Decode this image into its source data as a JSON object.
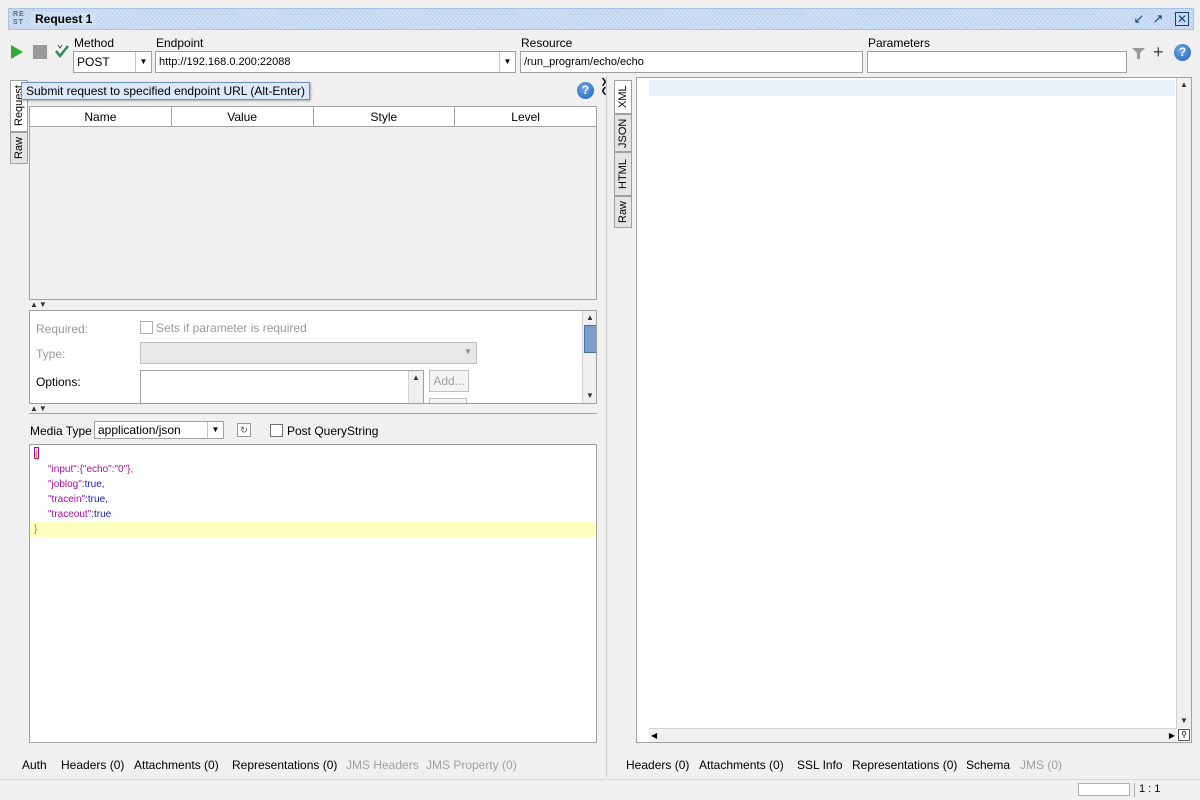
{
  "window": {
    "title": "Request 1",
    "logo_text": "RE ST"
  },
  "toolbar": {
    "method_label": "Method",
    "method_value": "POST",
    "endpoint_label": "Endpoint",
    "endpoint_value": "http://192.168.0.200:22088",
    "resource_label": "Resource",
    "resource_value": "/run_program/echo/echo",
    "parameters_label": "Parameters",
    "parameters_value": "",
    "icons": [
      "play-icon",
      "stop-icon",
      "check-icon",
      "clear-icon",
      "plus-icon",
      "help-icon"
    ]
  },
  "left_panel": {
    "tabs": [
      "Request",
      "Raw"
    ],
    "tooltip": "Submit request to specified endpoint URL (Alt-Enter)",
    "table_columns": [
      "Name",
      "Value",
      "Style",
      "Level"
    ],
    "details": {
      "required_label": "Required:",
      "required_checkbox_label": "Sets if parameter is required",
      "type_label": "Type:",
      "options_label": "Options:",
      "add_button": "Add..."
    },
    "media_type_label": "Media Type",
    "media_type_value": "application/json",
    "post_querystring_label": "Post QueryString",
    "body_lines": [
      {
        "text": "{",
        "kind": "brace"
      },
      {
        "key": "\"input\"",
        "value": ":{\"echo\":\"0\"},"
      },
      {
        "key": "\"joblog\"",
        "value": ":true,"
      },
      {
        "key": "\"tracein\"",
        "value": ":true,"
      },
      {
        "key": "\"traceout\"",
        "value": ":true"
      },
      {
        "text": "}",
        "kind": "brace"
      }
    ],
    "bottom_tabs": [
      {
        "label": "Auth",
        "enabled": true
      },
      {
        "label": "Headers (0)",
        "enabled": true
      },
      {
        "label": "Attachments (0)",
        "enabled": true
      },
      {
        "label": "Representations (0)",
        "enabled": true
      },
      {
        "label": "JMS Headers",
        "enabled": false
      },
      {
        "label": "JMS Property (0)",
        "enabled": false
      }
    ]
  },
  "right_panel": {
    "tabs": [
      "XML",
      "JSON",
      "HTML",
      "Raw"
    ],
    "bottom_tabs": [
      {
        "label": "Headers (0)",
        "enabled": true
      },
      {
        "label": "Attachments (0)",
        "enabled": true
      },
      {
        "label": "SSL Info",
        "enabled": true
      },
      {
        "label": "Representations (0)",
        "enabled": true
      },
      {
        "label": "Schema",
        "enabled": true
      },
      {
        "label": "JMS (0)",
        "enabled": false
      }
    ]
  },
  "status_bar": {
    "position": "1 : 1"
  },
  "colors": {
    "title_bg": "#cfe0f4",
    "json_key": "#a0119c",
    "json_value": "#1a1aa6",
    "current_line": "#ffffc0",
    "help_blue": "#1e5fb4"
  }
}
